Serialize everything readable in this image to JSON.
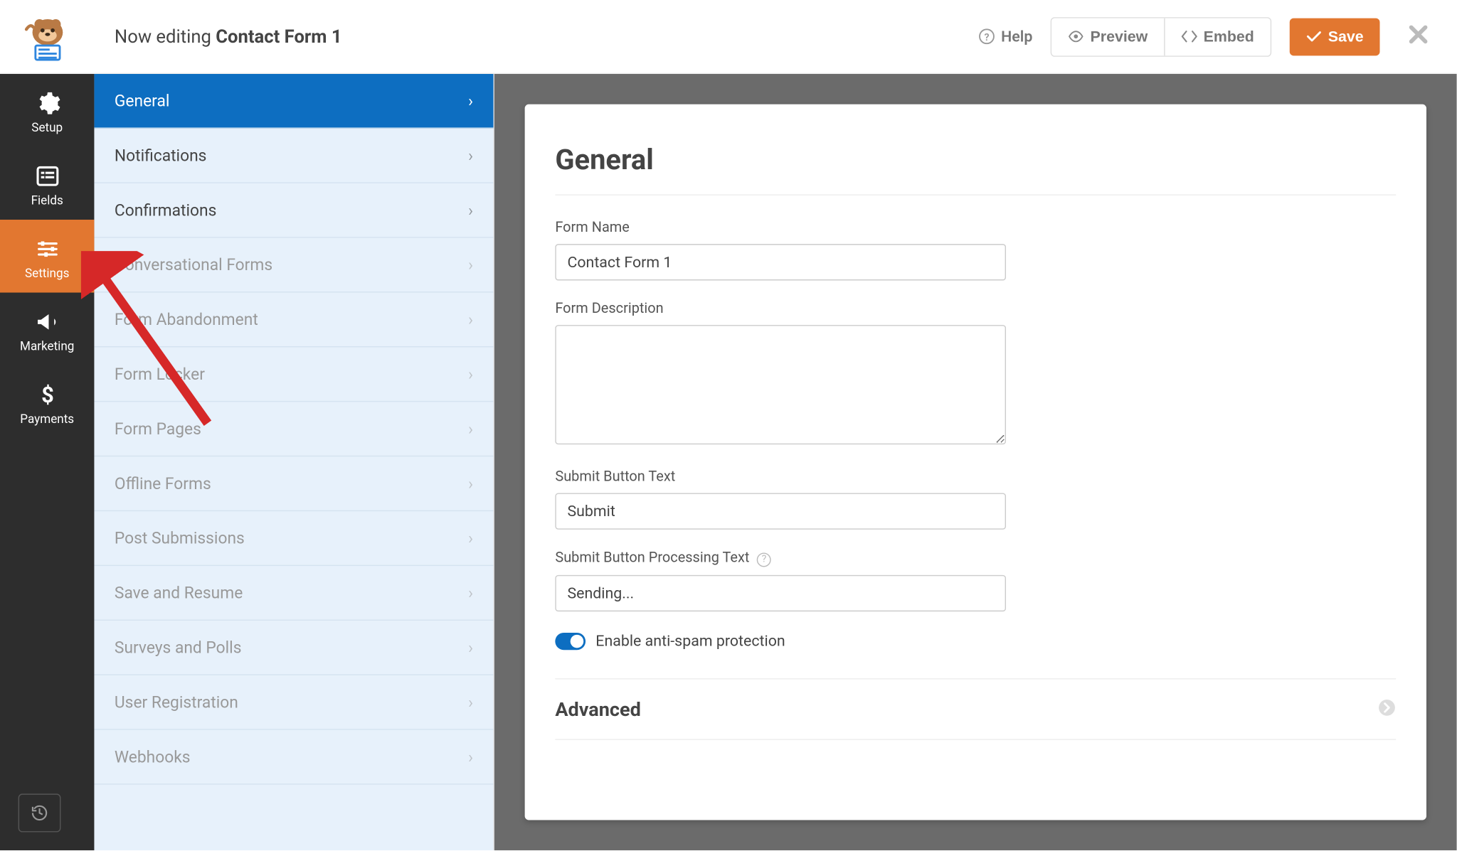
{
  "topbar": {
    "now_editing_prefix": "Now editing ",
    "form_title": "Contact Form 1",
    "help": "Help",
    "preview": "Preview",
    "embed": "Embed",
    "save": "Save"
  },
  "nav": {
    "setup": "Setup",
    "fields": "Fields",
    "settings": "Settings",
    "marketing": "Marketing",
    "payments": "Payments"
  },
  "sidebar": {
    "items": [
      {
        "label": "General",
        "enabled": true,
        "active": true
      },
      {
        "label": "Notifications",
        "enabled": true
      },
      {
        "label": "Confirmations",
        "enabled": true
      },
      {
        "label": "Conversational Forms"
      },
      {
        "label": "Form Abandonment"
      },
      {
        "label": "Form Locker"
      },
      {
        "label": "Form Pages"
      },
      {
        "label": "Offline Forms"
      },
      {
        "label": "Post Submissions"
      },
      {
        "label": "Save and Resume"
      },
      {
        "label": "Surveys and Polls"
      },
      {
        "label": "User Registration"
      },
      {
        "label": "Webhooks"
      }
    ]
  },
  "panel": {
    "heading": "General",
    "form_name_label": "Form Name",
    "form_name_value": "Contact Form 1",
    "form_desc_label": "Form Description",
    "form_desc_value": "",
    "submit_text_label": "Submit Button Text",
    "submit_text_value": "Submit",
    "submit_proc_label": "Submit Button Processing Text",
    "submit_proc_value": "Sending...",
    "antispam_label": "Enable anti-spam protection",
    "advanced_label": "Advanced"
  },
  "colors": {
    "accent": "#e27730",
    "primary": "#0d6ec1",
    "nav_bg": "#2d2d2d",
    "side_bg": "#e7f1fb"
  }
}
